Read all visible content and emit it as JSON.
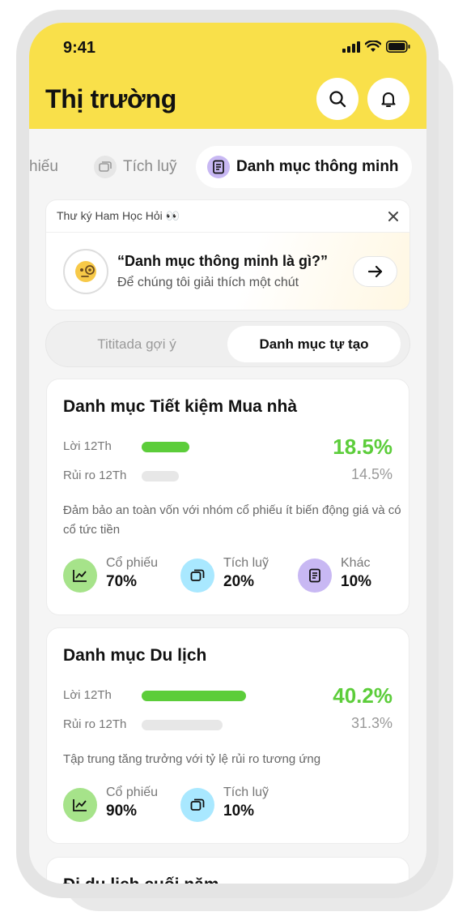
{
  "status": {
    "time": "9:41"
  },
  "header": {
    "title": "Thị trường"
  },
  "tabs": [
    {
      "label": "hiếu"
    },
    {
      "label": "Tích luỹ"
    },
    {
      "label": "Danh mục thông  minh"
    }
  ],
  "assistant": {
    "title": "Thư ký Ham Học Hỏi 👀",
    "question": "“Danh mục thông minh là gì?”",
    "subtitle": "Để chúng tôi giải thích một chút"
  },
  "segment": {
    "left": "Tititada gợi ý",
    "right": "Danh mục tự tạo"
  },
  "portfolios": [
    {
      "title": "Danh mục Tiết kiệm Mua nhà",
      "profit_label": "Lời 12Th",
      "profit_value": "18.5%",
      "profit": 0.185,
      "risk_label": "Rủi ro 12Th",
      "risk_value": "14.5%",
      "risk": 0.145,
      "description": "Đảm bảo an toàn vốn với nhóm cổ phiếu ít biến động giá và có cổ tức tiền",
      "allocations": [
        {
          "name": "Cổ phiếu",
          "pct": "70%"
        },
        {
          "name": "Tích luỹ",
          "pct": "20%"
        },
        {
          "name": "Khác",
          "pct": "10%"
        }
      ]
    },
    {
      "title": "Danh mục Du lịch",
      "profit_label": "Lời 12Th",
      "profit_value": "40.2%",
      "profit": 0.402,
      "risk_label": "Rủi ro 12Th",
      "risk_value": "31.3%",
      "risk": 0.313,
      "description": "Tập trung tăng trưởng với tỷ lệ rủi ro tương ứng",
      "allocations": [
        {
          "name": "Cổ phiếu",
          "pct": "90%"
        },
        {
          "name": "Tích luỹ",
          "pct": "10%"
        }
      ]
    },
    {
      "title": "Đi du lịch cuối năm"
    }
  ],
  "colors": {
    "header_bg": "#f9e04a",
    "profit_green": "#5ccd3a",
    "accent_purple": "#c8b8f3",
    "accent_blue": "#a9e8ff"
  },
  "icons": [
    "search-icon",
    "bell-icon",
    "stock-chart-icon",
    "savings-icon",
    "document-icon",
    "close-icon",
    "arrow-right-icon"
  ]
}
